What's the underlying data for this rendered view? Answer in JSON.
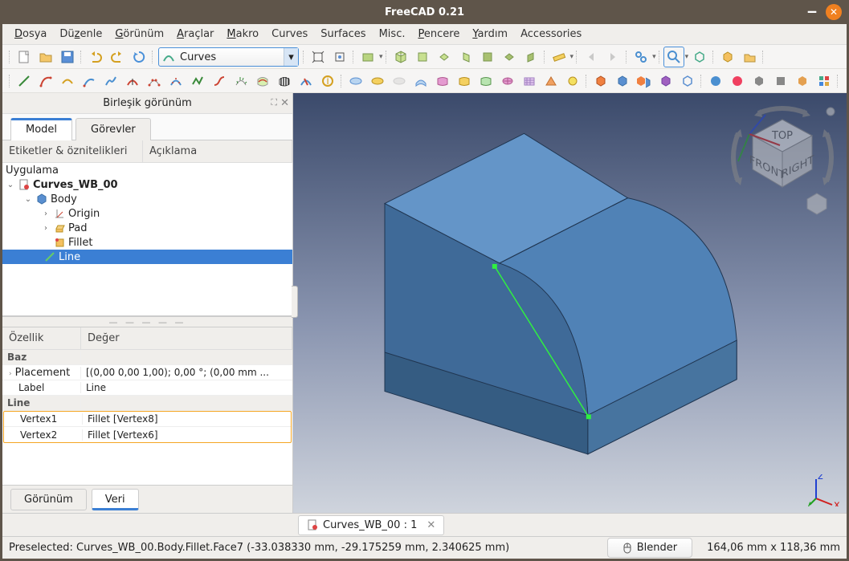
{
  "window": {
    "title": "FreeCAD 0.21"
  },
  "menu": {
    "file": "Dosya",
    "edit": "Düzenle",
    "view": "Görünüm",
    "tools": "Araçlar",
    "macro": "Makro",
    "curves": "Curves",
    "surfaces": "Surfaces",
    "misc": "Misc.",
    "windows": "Pencere",
    "help": "Yardım",
    "acc": "Accessories"
  },
  "workbench": {
    "selected": "Curves"
  },
  "panel": {
    "title": "Birleşik görünüm"
  },
  "tabs": {
    "model": "Model",
    "tasks": "Görevler"
  },
  "tree": {
    "headers": {
      "labels": "Etiketler & öznitelikleri",
      "desc": "Açıklama"
    },
    "app": "Uygulama",
    "doc": "Curves_WB_00",
    "body": "Body",
    "origin": "Origin",
    "pad": "Pad",
    "fillet": "Fillet",
    "line": "Line"
  },
  "props": {
    "headers": {
      "prop": "Özellik",
      "val": "Değer"
    },
    "grp_base": "Baz",
    "placement_k": "Placement",
    "placement_v": "[(0,00 0,00 1,00); 0,00 °; (0,00 mm ...",
    "label_k": "Label",
    "label_v": "Line",
    "grp_line": "Line",
    "v1_k": "Vertex1",
    "v1_v": "Fillet [Vertex8]",
    "v2_k": "Vertex2",
    "v2_v": "Fillet [Vertex6]"
  },
  "bottom_tabs": {
    "view": "Görünüm",
    "data": "Veri"
  },
  "doc_tab": {
    "label": "Curves_WB_00 : 1"
  },
  "status": {
    "preselect": "Preselected: Curves_WB_00.Body.Fillet.Face7 (-33.038330 mm, -29.175259 mm, 2.340625 mm)",
    "nav": "Blender",
    "dims": "164,06 mm x 118,36 mm"
  },
  "navcube": {
    "top": "TOP",
    "front": "FRONT",
    "right": "RIGHT"
  }
}
